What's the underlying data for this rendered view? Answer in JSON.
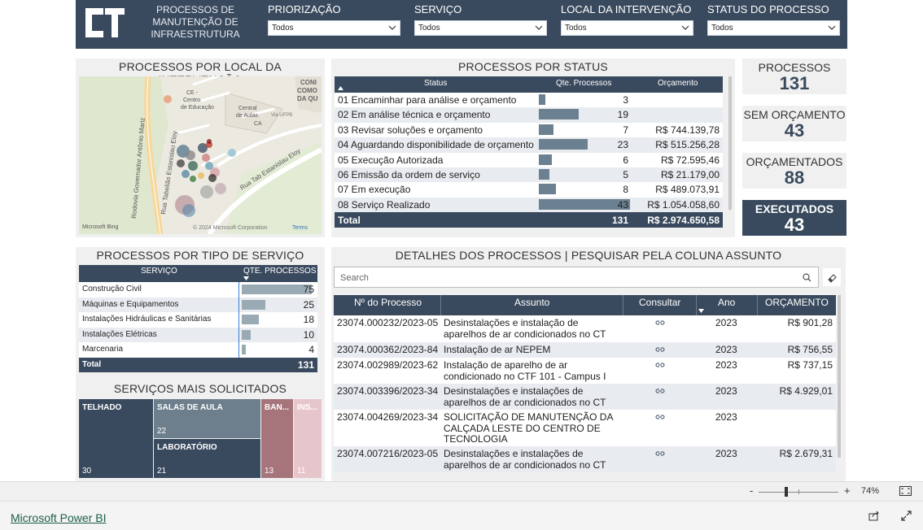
{
  "header": {
    "title_lines": [
      "PROCESSOS DE",
      "MANUTENÇÃO DE",
      "INFRAESTRUTURA"
    ],
    "slicers": [
      {
        "label": "PRIORIZAÇÃO",
        "value": "Todos"
      },
      {
        "label": "SERVIÇO",
        "value": "Todos"
      },
      {
        "label": "LOCAL DA INTERVENÇÃO",
        "value": "Todos"
      },
      {
        "label": "STATUS DO PROCESSO",
        "value": "Todos"
      }
    ]
  },
  "map": {
    "title": "PROCESSOS POR LOCAL DA INTERVENÇÃO",
    "labels": {
      "rod": "Rodovia Governador Antônio Mariz",
      "rua1": "Rua Tabelião Estanislau Eloy",
      "rua2": "Rua Tab Estanislau Eloy",
      "ce": "CE -",
      "centro": "Centro",
      "educ": "de Educação",
      "central": "Central",
      "aulas": "de Aulas",
      "ca": "CA",
      "via": "Via UFPB",
      "co1": "CONI",
      "co2": "COMO",
      "co3": "DA QU"
    },
    "bing": "Microsoft Bing",
    "copyright": "© 2024 Microsoft Corporation",
    "terms": "Terms"
  },
  "status": {
    "title": "PROCESSOS POR STATUS",
    "headers": [
      "Status",
      "Qte. Processos",
      "Orçamento"
    ],
    "rows": [
      {
        "status": "01 Encaminhar para análise e orçamento",
        "qty": 3,
        "qty_text": "3",
        "orc": ""
      },
      {
        "status": "02 Em análise técnica e orçamento",
        "qty": 19,
        "qty_text": "19",
        "orc": ""
      },
      {
        "status": "03 Revisar soluções e orçamento",
        "qty": 7,
        "qty_text": "7",
        "orc": "R$ 744.139,78"
      },
      {
        "status": "04 Aguardando disponibilidade de orçamento",
        "qty": 23,
        "qty_text": "23",
        "orc": "R$ 515.256,28"
      },
      {
        "status": "05 Execução Autorizada",
        "qty": 6,
        "qty_text": "6",
        "orc": "R$ 72.595,46"
      },
      {
        "status": "06 Emissão da ordem de serviço",
        "qty": 5,
        "qty_text": "5",
        "orc": "R$ 21.179,00"
      },
      {
        "status": "07 Em execução",
        "qty": 8,
        "qty_text": "8",
        "orc": "R$ 489.073,91"
      },
      {
        "status": "08 Serviço Realizado",
        "qty": 43,
        "qty_text": "43",
        "orc": "R$ 1.054.058,60"
      }
    ],
    "total_label": "Total",
    "total_qty": "131",
    "total_orc": "R$ 2.974.650,58"
  },
  "kpis": [
    {
      "label": "PROCESSOS",
      "value": "131"
    },
    {
      "label": "SEM ORÇAMENTO",
      "value": "43"
    },
    {
      "label": "ORÇAMENTADOS",
      "value": "88"
    },
    {
      "label": "EXECUTADOS",
      "value": "43"
    }
  ],
  "tipo": {
    "title": "PROCESSOS POR TIPO DE SERVIÇO",
    "headers": [
      "SERVIÇO",
      "QTE. PROCESSOS"
    ],
    "rows": [
      {
        "name": "Construção Civil",
        "qty": 75,
        "qty_text": "75"
      },
      {
        "name": "Máquinas e Equipamentos",
        "qty": 25,
        "qty_text": "25"
      },
      {
        "name": "Instalações Hidráulicas e Sanitárias",
        "qty": 18,
        "qty_text": "18"
      },
      {
        "name": "Instalações Elétricas",
        "qty": 10,
        "qty_text": "10"
      },
      {
        "name": "Marcenaria",
        "qty": 4,
        "qty_text": "4"
      }
    ],
    "total_label": "Total",
    "total_qty": "131"
  },
  "treemap": {
    "title": "SERVIÇOS MAIS SOLICITADOS",
    "items": [
      {
        "name": "TELHADO",
        "value": "30"
      },
      {
        "name": "SALAS DE AULA",
        "value": "22"
      },
      {
        "name": "LABORATÓRIO",
        "value": "21"
      },
      {
        "name": "BAN...",
        "value": "13"
      },
      {
        "name": "INS...",
        "value": "11"
      }
    ]
  },
  "details": {
    "title": "DETALHES DOS PROCESSOS | PESQUISAR PELA COLUNA ASSUNTO",
    "search_placeholder": "Search",
    "headers": [
      "Nº do Processo",
      "Assunto",
      "Consultar",
      "Ano",
      "ORÇAMENTO"
    ],
    "rows": [
      {
        "num": "23074.000232/2023-05",
        "assunto": [
          "Desinstalações e instalação de",
          "aparelhos de ar condicionados no CT"
        ],
        "ano": "2023",
        "orc": "R$ 901,28"
      },
      {
        "num": "23074.000362/2023-84",
        "assunto": [
          "Instalação de ar NEPEM"
        ],
        "ano": "2023",
        "orc": "R$ 756,55"
      },
      {
        "num": "23074.002989/2023-62",
        "assunto": [
          "Instalação de aparelho de ar",
          "condicionado no CTF 101 - Campus I"
        ],
        "ano": "2023",
        "orc": "R$ 737,15"
      },
      {
        "num": "23074.003396/2023-34",
        "assunto": [
          "Desinstalações e instalações de",
          "aparelhos de ar condicionados no CT"
        ],
        "ano": "2023",
        "orc": "R$ 4.929,01"
      },
      {
        "num": "23074.004269/2023-34",
        "assunto": [
          "SOLICITAÇÃO DE MANUTENÇÃO DA",
          "CALÇADA LESTE DO CENTRO DE",
          "TECNOLOGIA"
        ],
        "ano": "2023",
        "orc": ""
      },
      {
        "num": "23074.007216/2023-05",
        "assunto": [
          "Desinstalações e instalações de",
          "aparelhos de ar condicionados no CT"
        ],
        "ano": "2023",
        "orc": "R$ 2.679,31"
      }
    ]
  },
  "zoom": {
    "level": "74%",
    "minus": "-",
    "plus": "+"
  },
  "footer": {
    "brand": "Microsoft Power BI"
  },
  "colors": {
    "navy": "#3a4a5e",
    "bar": "#6b8091",
    "tm_dark": "#3a4a5e",
    "tm_mid": "#6d7f8c",
    "tm_rose": "#a6757c",
    "tm_pink": "#e7c6cb"
  }
}
